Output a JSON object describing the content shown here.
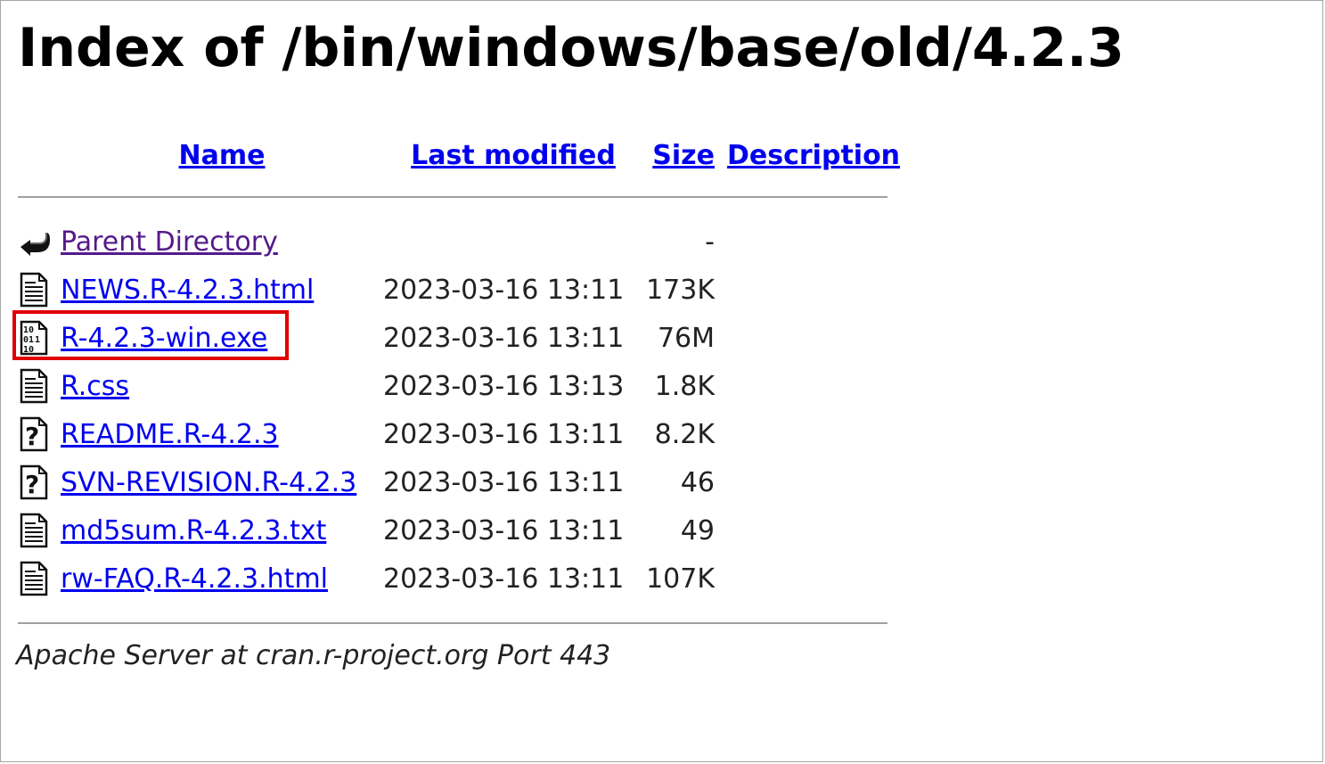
{
  "page": {
    "title": "Index of /bin/windows/base/old/4.2.3"
  },
  "columns": {
    "name": "Name",
    "last_modified": "Last modified",
    "size": "Size",
    "description": "Description"
  },
  "entries": [
    {
      "name": "Parent Directory",
      "date": "",
      "size": "-",
      "icon": "back-icon",
      "visited": true
    },
    {
      "name": "NEWS.R-4.2.3.html",
      "date": "2023-03-16 13:11",
      "size": "173K",
      "icon": "text-file-icon"
    },
    {
      "name": "R-4.2.3-win.exe",
      "date": "2023-03-16 13:11",
      "size": "76M",
      "icon": "binary-file-icon",
      "highlighted": true
    },
    {
      "name": "R.css",
      "date": "2023-03-16 13:13",
      "size": "1.8K",
      "icon": "text-file-icon"
    },
    {
      "name": "README.R-4.2.3",
      "date": "2023-03-16 13:11",
      "size": "8.2K",
      "icon": "unknown-file-icon"
    },
    {
      "name": "SVN-REVISION.R-4.2.3",
      "date": "2023-03-16 13:11",
      "size": "46",
      "icon": "unknown-file-icon"
    },
    {
      "name": "md5sum.R-4.2.3.txt",
      "date": "2023-03-16 13:11",
      "size": "49",
      "icon": "text-file-icon"
    },
    {
      "name": "rw-FAQ.R-4.2.3.html",
      "date": "2023-03-16 13:11",
      "size": "107K",
      "icon": "text-file-icon"
    }
  ],
  "footer": {
    "text": "Apache Server at cran.r-project.org Port 443"
  },
  "colors": {
    "link": "#0000ee",
    "visited_link": "#551a8b",
    "highlight_border": "#e00000",
    "rule": "#a0a0a0"
  }
}
